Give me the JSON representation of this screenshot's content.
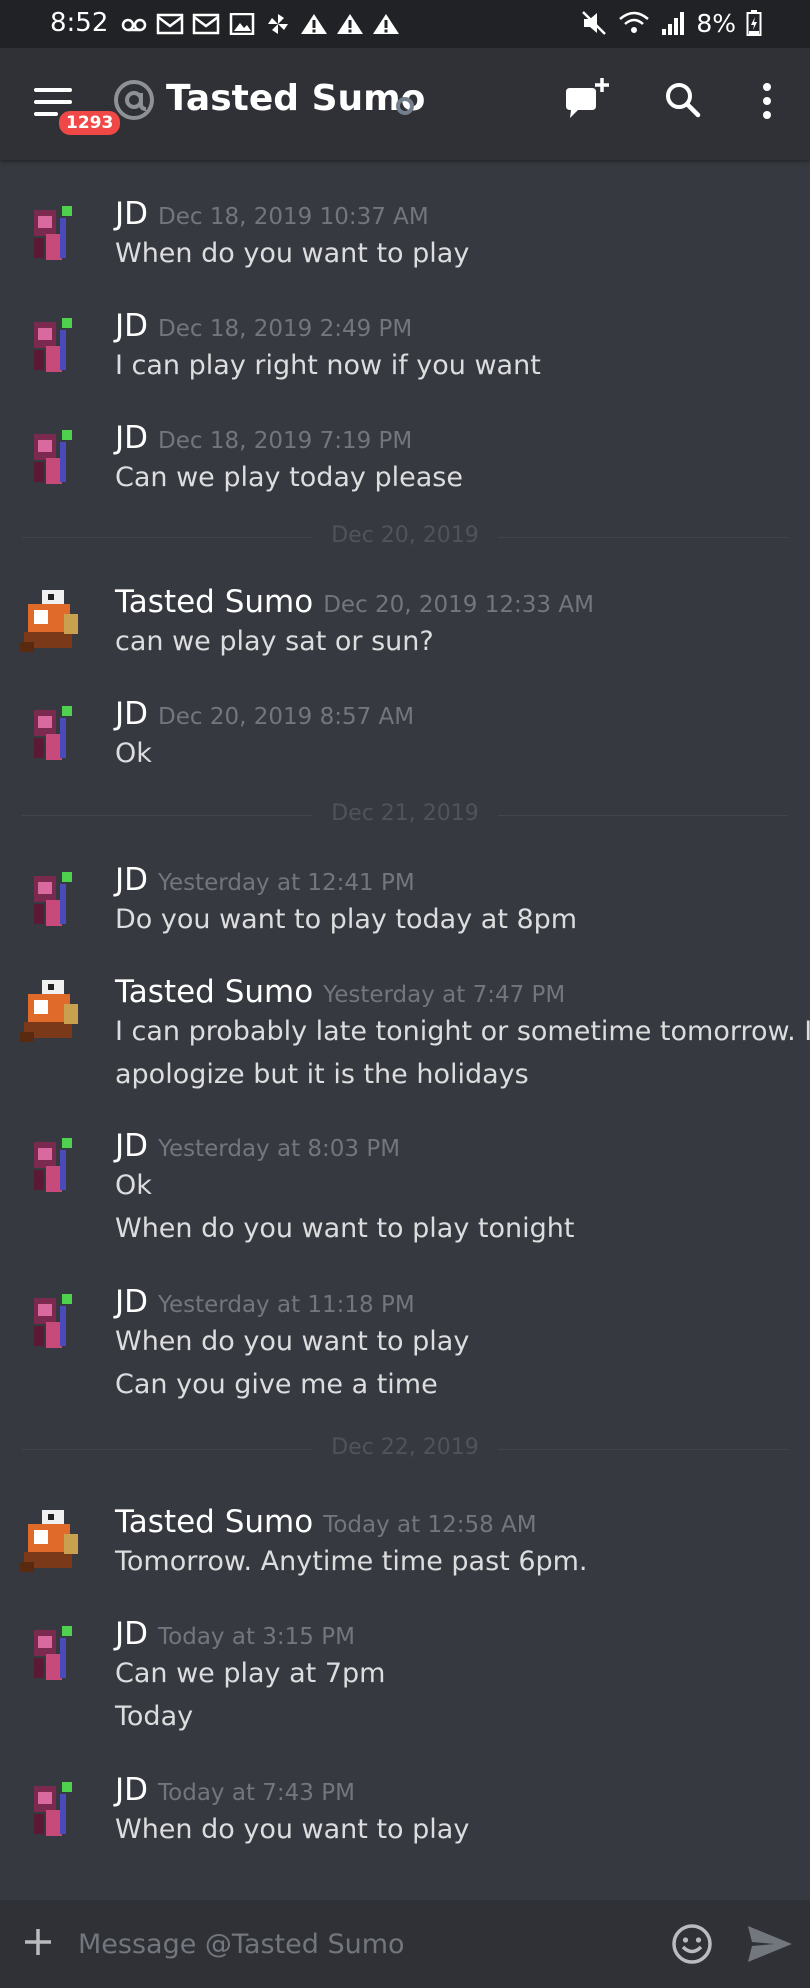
{
  "status_bar": {
    "time": "8:52",
    "battery": "8%",
    "icons": [
      "voicemail-icon",
      "mail-icon",
      "mail-icon",
      "image-icon",
      "pinwheel-icon",
      "warning-icon",
      "warning-icon",
      "warning-icon"
    ],
    "right_icons": [
      "mute-icon",
      "wifi-icon",
      "signal-icon",
      "battery-icon"
    ]
  },
  "header": {
    "badge_count": "1293",
    "channel_name": "Tasted Sumo",
    "colors": {
      "badge": "#f04747",
      "offline_dot": "#747f8d"
    }
  },
  "messages": [
    {
      "author": "JD",
      "timestamp": "Dec 18, 2019 10:37 AM",
      "lines": [
        "When do you want to play"
      ],
      "avatar": "jd-avatar"
    },
    {
      "author": "JD",
      "timestamp": "Dec 18, 2019 2:49 PM",
      "lines": [
        "I can play right now if you want"
      ],
      "avatar": "jd-avatar"
    },
    {
      "author": "JD",
      "timestamp": "Dec 18, 2019 7:19 PM",
      "lines": [
        "Can we play today please"
      ],
      "avatar": "jd-avatar"
    },
    {
      "divider": "Dec 20, 2019"
    },
    {
      "author": "Tasted Sumo",
      "timestamp": "Dec 20, 2019 12:33 AM",
      "lines": [
        "can we play sat or sun?"
      ],
      "avatar": "tasted-sumo-avatar"
    },
    {
      "author": "JD",
      "timestamp": "Dec 20, 2019 8:57 AM",
      "lines": [
        "Ok"
      ],
      "avatar": "jd-avatar"
    },
    {
      "divider": "Dec 21, 2019"
    },
    {
      "author": "JD",
      "timestamp": "Yesterday at 12:41 PM",
      "lines": [
        "Do you want to play today at 8pm"
      ],
      "avatar": "jd-avatar"
    },
    {
      "author": "Tasted Sumo",
      "timestamp": "Yesterday at 7:47 PM",
      "lines": [
        "I can probably late tonight or sometime tomorrow. I",
        "apologize but it is the holidays"
      ],
      "avatar": "tasted-sumo-avatar"
    },
    {
      "author": "JD",
      "timestamp": "Yesterday at 8:03 PM",
      "lines": [
        "Ok",
        "When do you want to play tonight"
      ],
      "avatar": "jd-avatar"
    },
    {
      "author": "JD",
      "timestamp": "Yesterday at 11:18 PM",
      "lines": [
        "When do you want to play",
        "Can you give me a time"
      ],
      "avatar": "jd-avatar"
    },
    {
      "divider": "Dec 22, 2019"
    },
    {
      "author": "Tasted Sumo",
      "timestamp": "Today at 12:58 AM",
      "lines": [
        "Tomorrow. Anytime time past 6pm."
      ],
      "avatar": "tasted-sumo-avatar"
    },
    {
      "author": "JD",
      "timestamp": "Today at 3:15 PM",
      "lines": [
        "Can we play at 7pm",
        "Today"
      ],
      "avatar": "jd-avatar"
    },
    {
      "author": "JD",
      "timestamp": "Today at 7:43 PM",
      "lines": [
        "When do you want to play"
      ],
      "avatar": "jd-avatar"
    }
  ],
  "composer": {
    "placeholder": "Message @Tasted Sumo"
  }
}
